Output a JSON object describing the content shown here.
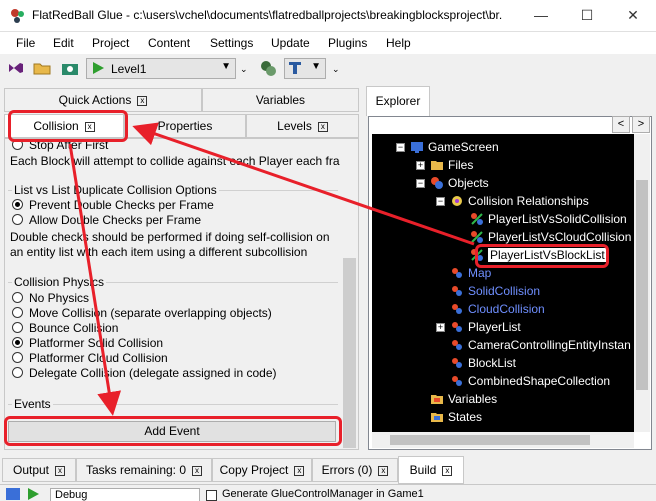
{
  "window": {
    "title": "FlatRedBall Glue - c:\\users\\vchel\\documents\\flatredballprojects\\breakingblocksproject\\br...",
    "minimize": "—",
    "maximize": "☐",
    "close": "✕"
  },
  "menu": [
    "File",
    "Edit",
    "Project",
    "Content",
    "Settings",
    "Update",
    "Plugins",
    "Help"
  ],
  "toolbar": {
    "level_select": "Level1",
    "icons": [
      "visual-studio-icon",
      "folder-icon",
      "camera-icon",
      "play-icon",
      "glue-icon",
      "t-tool-icon"
    ]
  },
  "left_tabs_row1": [
    {
      "label": "Quick Actions",
      "close": "x"
    },
    {
      "label": "Variables"
    }
  ],
  "left_tabs_row2": [
    {
      "label": "Collision",
      "close": "x"
    },
    {
      "label": "Properties"
    },
    {
      "label": "Levels",
      "close": "x"
    }
  ],
  "collision_panel": {
    "stop_after_first": "Stop After First",
    "each_block_text": "Each Block will attempt to collide against each Player each fra",
    "duplicate_group": {
      "title": "List vs List Duplicate Collision Options",
      "options": [
        "Prevent Double Checks per Frame",
        "Allow Double Checks per Frame"
      ],
      "selected": 0,
      "help_line1": "Double checks should be performed if doing self-collision on",
      "help_line2": "an entity list with each item using a different subcollision"
    },
    "physics_group": {
      "title": "Collision Physics",
      "options": [
        "No Physics",
        "Move Collision (separate overlapping objects)",
        "Bounce Collision",
        "Platformer Solid Collision",
        "Platformer Cloud Collision",
        "Delegate Collision (delegate assigned in code)"
      ],
      "selected": 3
    },
    "events_group": {
      "title": "Events",
      "add_event": "Add Event"
    }
  },
  "explorer": {
    "tab": "Explorer",
    "scroll_left": "<",
    "scroll_right": ">",
    "nodes": [
      {
        "label": "GameScreen",
        "expander": "−"
      },
      {
        "label": "Files",
        "expander": "+"
      },
      {
        "label": "Objects",
        "expander": "−"
      },
      {
        "label": "Collision Relationships",
        "expander": "−"
      },
      {
        "label": "PlayerListVsSolidCollision"
      },
      {
        "label": "PlayerListVsCloudCollision"
      },
      {
        "label": "PlayerListVsBlockList"
      },
      {
        "label": "Map"
      },
      {
        "label": "SolidCollision"
      },
      {
        "label": "CloudCollision"
      },
      {
        "label": "PlayerList",
        "expander": "+"
      },
      {
        "label": "CameraControllingEntityInstan"
      },
      {
        "label": "BlockList"
      },
      {
        "label": "CombinedShapeCollection"
      },
      {
        "label": "Variables"
      },
      {
        "label": "States"
      }
    ]
  },
  "bottom_tabs": [
    {
      "label": "Output",
      "close": "x"
    },
    {
      "label": "Tasks remaining: 0",
      "close": "x"
    },
    {
      "label": "Copy Project",
      "close": "x"
    },
    {
      "label": "Errors (0)",
      "close": "x"
    },
    {
      "label": "Build",
      "close": "x"
    }
  ],
  "status": {
    "config": "Debug",
    "checkbox_label": "Generate GlueControlManager in Game1"
  },
  "colors": {
    "highlight": "#e8202a",
    "tree_bg": "#000000",
    "blue_node": "#6f8fff"
  }
}
